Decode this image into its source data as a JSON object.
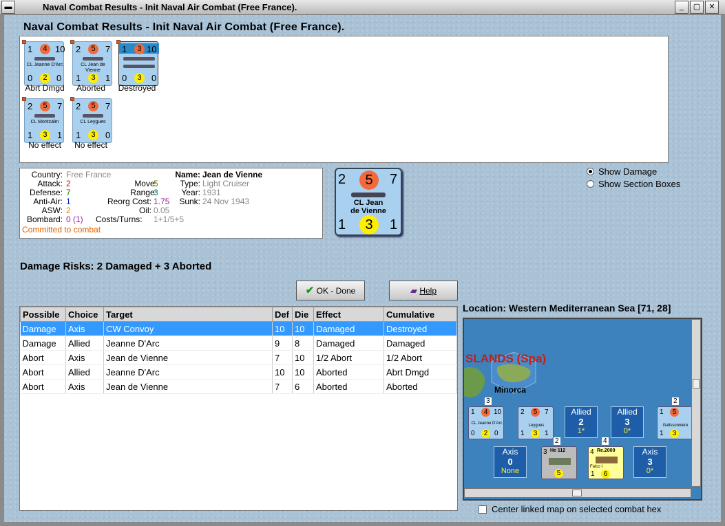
{
  "window": {
    "title": "Naval Combat Results - Init Naval Air Combat (Free France)."
  },
  "heading": "Naval Combat Results - Init Naval Air Combat (Free France).",
  "units": [
    {
      "name": "CL Jeanne D'Arc",
      "top": [
        "1",
        "4",
        "10"
      ],
      "bottom": [
        "0",
        "2",
        "0"
      ],
      "caption": "Abrt Dmgd"
    },
    {
      "name": "CL Jean de Vienne",
      "top": [
        "2",
        "5",
        "7"
      ],
      "bottom": [
        "1",
        "3",
        "1"
      ],
      "caption": "Aborted"
    },
    {
      "name": "",
      "top": [
        "1",
        "3",
        "10"
      ],
      "bottom": [
        "0",
        "3",
        "0"
      ],
      "caption": "Destroyed"
    },
    {
      "name": "CL Montcalm",
      "top": [
        "2",
        "5",
        "7"
      ],
      "bottom": [
        "1",
        "3",
        "1"
      ],
      "caption": "No effect"
    },
    {
      "name": "CL Leygues",
      "top": [
        "2",
        "5",
        "7"
      ],
      "bottom": [
        "1",
        "3",
        "0"
      ],
      "caption": "No effect"
    }
  ],
  "info": {
    "country_label": "Country:",
    "country": "Free France",
    "attack_label": "Attack:",
    "attack": "2",
    "defense_label": "Defense:",
    "defense": "7",
    "antiair_label": "Anti-Air:",
    "antiair": "1",
    "asw_label": "ASW:",
    "asw": "2",
    "bombard_label": "Bombard:",
    "bombard": "0 (1)",
    "move_label": "Move:",
    "move": "5",
    "range_label": "Range:",
    "range": "3",
    "reorg_label": "Reorg Cost:",
    "reorg": "1.75",
    "oil_label": "Oil:",
    "oil": "0.05",
    "costs_label": "Costs/Turns:",
    "costs": "1+1/5+5",
    "name_label": "Name:",
    "name": "Jean de Vienne",
    "type_label": "Type:",
    "type": "Light Cruiser",
    "year_label": "Year:",
    "year": "1931",
    "sunk_label": "Sunk:",
    "sunk": "24 Nov 1943",
    "status": "Committed to combat"
  },
  "bigcard": {
    "top": [
      "2",
      "5",
      "7"
    ],
    "name1": "CL Jean",
    "name2": "de Vienne",
    "bottom": [
      "1",
      "3",
      "1"
    ]
  },
  "radios": {
    "show_damage": "Show Damage",
    "show_sections": "Show Section Boxes"
  },
  "damage_risks": "Damage Risks:  2 Damaged + 3 Aborted",
  "buttons": {
    "ok": "OK - Done",
    "help": "Help"
  },
  "table": {
    "headers": [
      "Possible",
      "Choice",
      "Target",
      "Def",
      "Die",
      "Effect",
      "Cumulative"
    ],
    "rows": [
      [
        "Damage",
        "Axis",
        "CW Convoy",
        "10",
        "10",
        "Damaged",
        "Destroyed"
      ],
      [
        "Damage",
        "Allied",
        "Jeanne D'Arc",
        "9",
        "8",
        "Damaged",
        "Damaged"
      ],
      [
        "Abort",
        "Axis",
        "Jean de Vienne",
        "7",
        "10",
        "1/2 Abort",
        "1/2 Abort"
      ],
      [
        "Abort",
        "Allied",
        "Jeanne D'Arc",
        "10",
        "10",
        "Aborted",
        "Abrt Dmgd"
      ],
      [
        "Abort",
        "Axis",
        "Jean de Vienne",
        "7",
        "6",
        "Aborted",
        "Aborted"
      ]
    ]
  },
  "location": "Location:  Western Mediterranean Sea [71, 28]",
  "map": {
    "islands_label": "SLANDS (Spa)",
    "minorca": "Minorca",
    "allied_boxes": [
      {
        "label": "Allied",
        "n": "2",
        "sub": "1*"
      },
      {
        "label": "Allied",
        "n": "3",
        "sub": "0*"
      }
    ],
    "axis_boxes": [
      {
        "label": "Axis",
        "n": "0",
        "sub": "None"
      },
      {
        "label": "Axis",
        "n": "3",
        "sub": "0*"
      }
    ],
    "map_units": [
      {
        "stack": "3",
        "name": "CL Jeanne D'Arc",
        "top": [
          "1",
          "4",
          "10"
        ],
        "bottom": [
          "0",
          "2",
          "0"
        ]
      },
      {
        "stack": "",
        "name": "Leygues",
        "top": [
          "2",
          "5",
          "7"
        ],
        "bottom": [
          "1",
          "3",
          "1"
        ]
      },
      {
        "stack": "2",
        "name": "Gallssonniere",
        "top": [
          "1",
          "5",
          ""
        ],
        "bottom": [
          "1",
          "3",
          ""
        ]
      }
    ],
    "air_units": [
      {
        "stack": "2",
        "name": "He 112",
        "top": "3",
        "bottom": "5"
      },
      {
        "stack": "4",
        "name": "Re.2000",
        "sub": "Falco I",
        "top": "4",
        "bottom": [
          "1",
          "6"
        ]
      }
    ]
  },
  "center_checkbox": "Center linked map on selected combat hex"
}
